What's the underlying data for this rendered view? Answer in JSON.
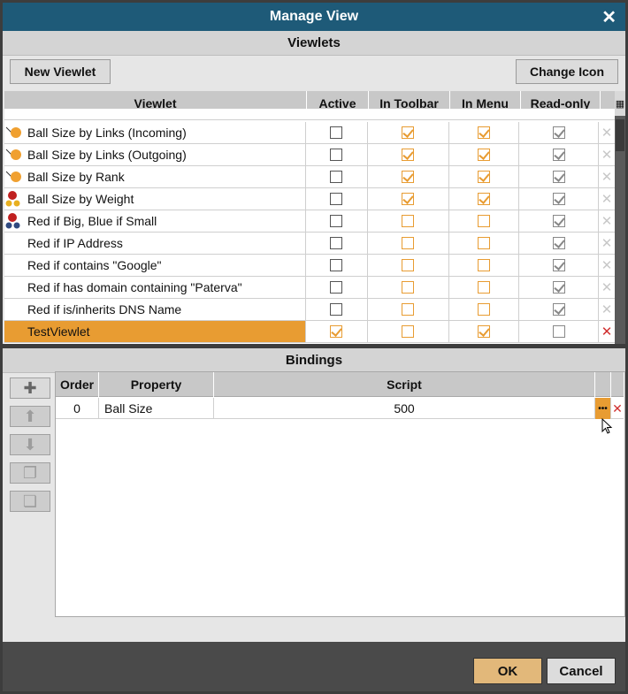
{
  "dialog": {
    "title": "Manage View"
  },
  "viewlets_section": {
    "heading": "Viewlets",
    "new_button": "New Viewlet",
    "change_icon_button": "Change Icon",
    "columns": [
      "Viewlet",
      "Active",
      "In Toolbar",
      "In Menu",
      "Read-only"
    ],
    "rows": [
      {
        "name": "Ball Size by Links (Incoming)",
        "icon": "orange-ball-incoming-icon",
        "active": false,
        "toolbar": true,
        "menu": true,
        "readonly": true
      },
      {
        "name": "Ball Size by Links (Outgoing)",
        "icon": "orange-ball-outgoing-icon",
        "active": false,
        "toolbar": true,
        "menu": true,
        "readonly": true
      },
      {
        "name": "Ball Size by Rank",
        "icon": "orange-ball-rank-icon",
        "active": false,
        "toolbar": true,
        "menu": true,
        "readonly": true
      },
      {
        "name": "Ball Size by Weight",
        "icon": "red-yellow-balls-icon",
        "active": false,
        "toolbar": true,
        "menu": true,
        "readonly": true
      },
      {
        "name": "Red if Big, Blue if Small",
        "icon": "red-blue-balls-icon",
        "active": false,
        "toolbar": false,
        "menu": false,
        "readonly": true
      },
      {
        "name": "Red if IP Address",
        "icon": "",
        "active": false,
        "toolbar": false,
        "menu": false,
        "readonly": true
      },
      {
        "name": "Red if contains \"Google\"",
        "icon": "",
        "active": false,
        "toolbar": false,
        "menu": false,
        "readonly": true
      },
      {
        "name": "Red if has domain containing \"Paterva\"",
        "icon": "",
        "active": false,
        "toolbar": false,
        "menu": false,
        "readonly": true
      },
      {
        "name": "Red if is/inherits DNS Name",
        "icon": "",
        "active": false,
        "toolbar": false,
        "menu": false,
        "readonly": true
      },
      {
        "name": "TestViewlet",
        "icon": "",
        "active": true,
        "toolbar": false,
        "menu": true,
        "readonly": false,
        "selected": true
      }
    ]
  },
  "bindings_section": {
    "heading": "Bindings",
    "columns": [
      "Order",
      "Property",
      "Script"
    ],
    "rows": [
      {
        "order": "0",
        "property": "Ball Size",
        "script": "500"
      }
    ],
    "edit_glyph": "•••",
    "delete_glyph": "✕"
  },
  "footer": {
    "ok": "OK",
    "cancel": "Cancel"
  },
  "colors": {
    "title_bar": "#1e5a78",
    "accent_orange": "#e89c32",
    "ok_button": "#e2b87a"
  }
}
